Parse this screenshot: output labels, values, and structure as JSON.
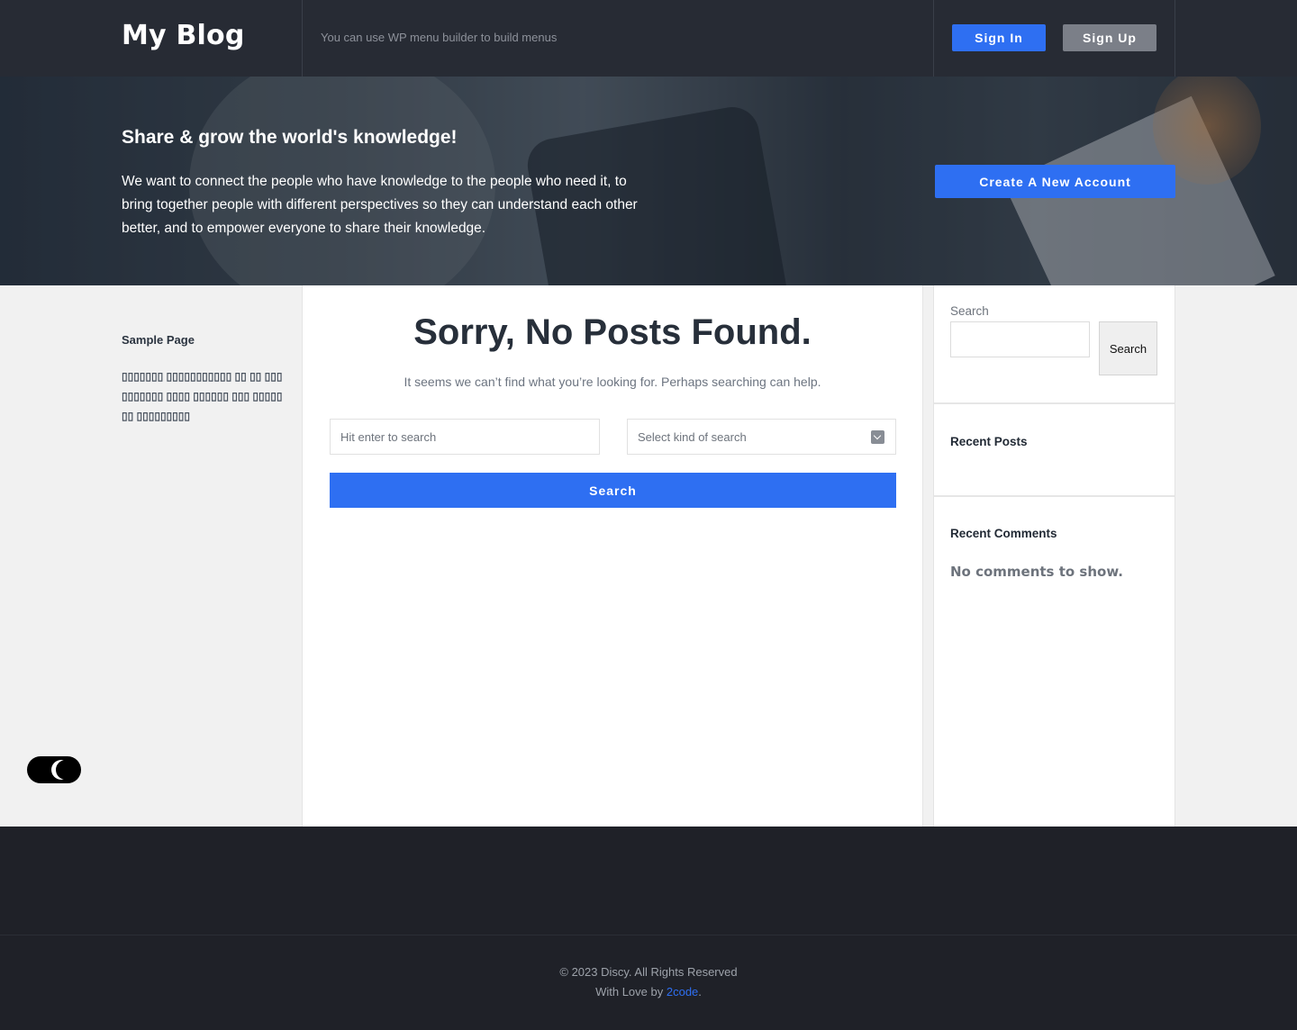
{
  "header": {
    "logo": "My Blog",
    "menu_hint": "You can use WP menu builder to build menus",
    "sign_in": "Sign In",
    "sign_up": "Sign Up"
  },
  "hero": {
    "title": "Share & grow the world's knowledge!",
    "text": "We want to connect the people who have knowledge to the people who need it, to bring together people with different perspectives so they can understand each other better, and to empower everyone to share their knowledge.",
    "cta": "Create A New Account"
  },
  "left_nav": {
    "items": [
      {
        "label": "Sample Page"
      }
    ],
    "sub_text": "▯▯▯▯▯▯▯ ▯▯▯▯▯▯▯▯▯▯▯ ▯▯ ▯▯ ▯▯▯ ▯▯▯▯▯▯▯ ▯▯▯▯ ▯▯▯▯▯▯ ▯▯▯ ▯▯▯▯▯▯▯ ▯▯▯▯▯▯▯▯▯"
  },
  "main": {
    "heading": "Sorry, No Posts Found.",
    "help": "It seems we can’t find what you’re looking for. Perhaps searching can help.",
    "search_placeholder": "Hit enter to search",
    "select_value": "Select kind of search",
    "search_button": "Search"
  },
  "sidebar": {
    "search_label": "Search",
    "search_button": "Search",
    "recent_posts_title": "Recent Posts",
    "recent_comments_title": "Recent Comments",
    "no_comments": "No comments to show."
  },
  "footer": {
    "copyright": "© 2023 Discy. All Rights Reserved",
    "love_prefix": "With Love by ",
    "love_link": "2code",
    "love_suffix": "."
  },
  "colors": {
    "accent": "#2e6ff2",
    "header_bg": "#272b34",
    "footer_bg": "#1f2128"
  }
}
